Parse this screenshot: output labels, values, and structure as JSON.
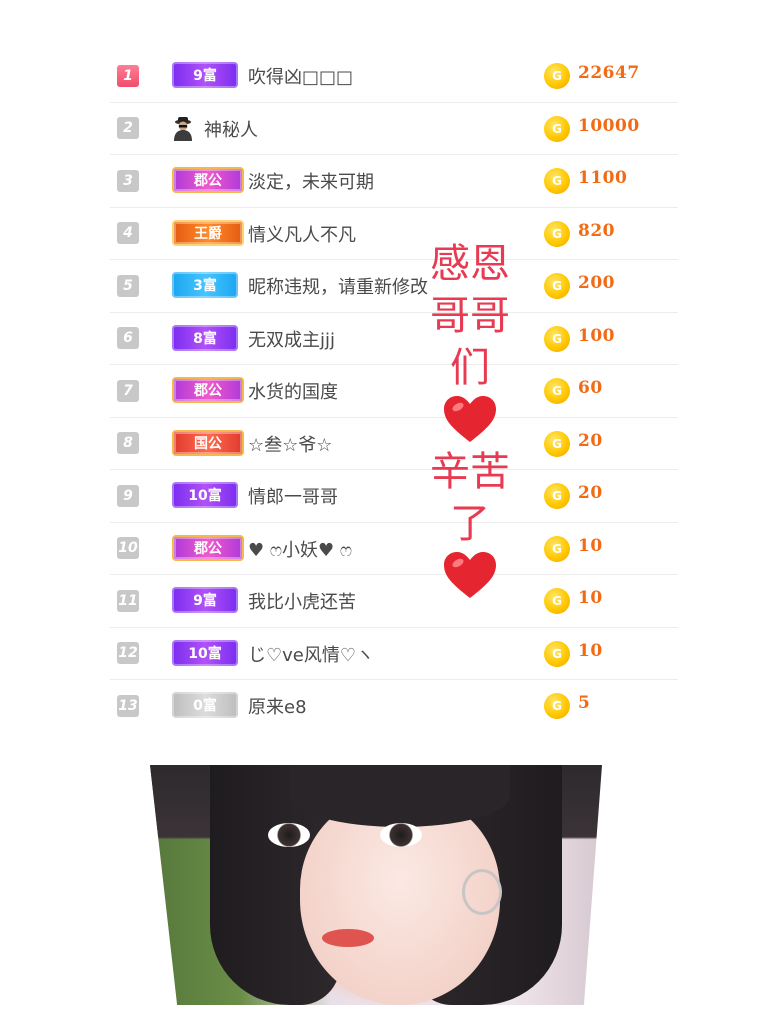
{
  "ranking": [
    {
      "rank": "1",
      "badge": "9富",
      "badge_style": "fu-purple",
      "name": "吹得凶□□□",
      "amount": "22647",
      "top": true
    },
    {
      "rank": "2",
      "badge": "",
      "badge_style": "mystery",
      "name": "神秘人",
      "amount": "10000"
    },
    {
      "rank": "3",
      "badge": "郡公",
      "badge_style": "gong-pink",
      "name": "淡定，未来可期",
      "amount": "1100"
    },
    {
      "rank": "4",
      "badge": "王爵",
      "badge_style": "jue-orange",
      "name": "情义凡人不凡",
      "amount": "820"
    },
    {
      "rank": "5",
      "badge": "3富",
      "badge_style": "fu-blue",
      "name": "昵称违规，请重新修改",
      "amount": "200"
    },
    {
      "rank": "6",
      "badge": "8富",
      "badge_style": "fu-purple",
      "name": "无双成主jjj",
      "amount": "100"
    },
    {
      "rank": "7",
      "badge": "郡公",
      "badge_style": "gong-pink",
      "name": "水货的国度",
      "amount": "60"
    },
    {
      "rank": "8",
      "badge": "国公",
      "badge_style": "gong-red",
      "name": "☆叁☆爷☆",
      "amount": "20"
    },
    {
      "rank": "9",
      "badge": "10富",
      "badge_style": "fu-purple",
      "name": "情郎一哥哥",
      "amount": "20"
    },
    {
      "rank": "10",
      "badge": "郡公",
      "badge_style": "gong-pink",
      "name": "♥ ෆ小妖♥ ෆ",
      "amount": "10"
    },
    {
      "rank": "11",
      "badge": "9富",
      "badge_style": "fu-purple",
      "name": "我比小虎还苦",
      "amount": "10"
    },
    {
      "rank": "12",
      "badge": "10富",
      "badge_style": "fu-purple",
      "name": "じ♡ve风情♡ヽ",
      "amount": "10"
    },
    {
      "rank": "13",
      "badge": "0富",
      "badge_style": "fu-grey",
      "name": "原来e8",
      "amount": "5"
    }
  ],
  "coin_glyph": "G",
  "overlay": {
    "line1": "感恩",
    "line2": "哥哥",
    "line3": "们",
    "line4": "辛苦",
    "line5": "了",
    "heart": "❤️",
    "color": "#e83a52"
  },
  "colors": {
    "amount": "#f26a14",
    "rank_bg": "#c8c8c8",
    "rank_top": "#f04d6c"
  },
  "icons": [
    "mystery-person-icon",
    "coin-icon",
    "heart-icon"
  ]
}
